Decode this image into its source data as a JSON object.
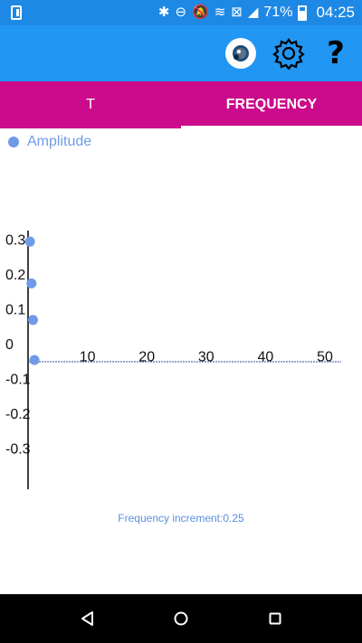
{
  "status_bar": {
    "battery": "71%",
    "time": "04:25",
    "icons": [
      "sim-icon",
      "bluetooth-icon",
      "do-not-disturb-icon",
      "notifications-off-icon",
      "wifi-icon",
      "no-signal-icon",
      "cell-signal-icon",
      "battery-icon"
    ]
  },
  "app_bar": {
    "actions": [
      "eye-icon",
      "gear-icon",
      "help-icon"
    ],
    "help_glyph": "?"
  },
  "tabs": [
    {
      "label": "T",
      "active": false
    },
    {
      "label": "FREQUENCY",
      "active": true
    }
  ],
  "colors": {
    "status_bar": "#1e88e5",
    "app_bar": "#2196f3",
    "tab_bar": "#cc0a8c",
    "series": "#6f9ae8",
    "baseline": "#2b4f8f"
  },
  "chart_data": {
    "type": "scatter",
    "legend_position": "top-left",
    "series": [
      {
        "name": "Amplitude",
        "x": [
          0.25,
          0.5,
          0.75,
          1.0
        ],
        "y": [
          0.345,
          0.225,
          0.12,
          0.005
        ]
      }
    ],
    "x_ticks": [
      "10",
      "20",
      "30",
      "40",
      "50"
    ],
    "x_tick_values": [
      10,
      20,
      30,
      40,
      50
    ],
    "y_ticks": [
      "0.3",
      "0.2",
      "0.1",
      "0",
      "-0.1",
      "-0.2",
      "-0.3"
    ],
    "y_tick_values": [
      0.3,
      0.2,
      0.1,
      0,
      -0.1,
      -0.2,
      -0.3
    ],
    "xlim": [
      0,
      50
    ],
    "ylim": [
      -0.35,
      0.35
    ],
    "grid": false
  },
  "footer": {
    "increment_text": "Frequency increment:0.25"
  },
  "nav_bar": {
    "buttons": [
      "back-icon",
      "home-icon",
      "recent-apps-icon"
    ]
  }
}
